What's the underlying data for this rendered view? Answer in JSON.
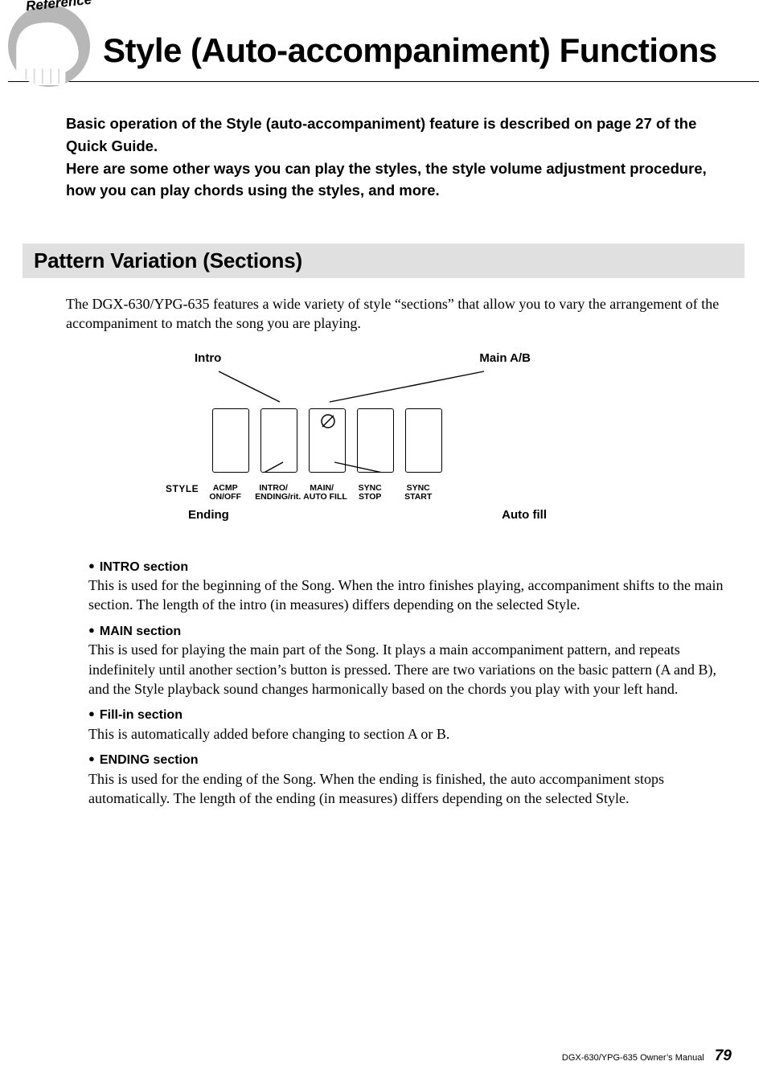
{
  "badge": {
    "text": "Reference"
  },
  "mainTitle": "Style (Auto-accompaniment) Functions",
  "introText": "Basic operation of the Style (auto-accompaniment) feature is described on page 27 of the Quick Guide.\nHere are some other ways you can play the styles, the style volume adjustment procedure, how you can play chords using the styles, and more.",
  "sectionBar": "Pattern Variation (Sections)",
  "sectionIntro": "The DGX-630/YPG-635 features a wide variety of style “sections” that allow you to vary the arrangement of the accompaniment to match the song you are playing.",
  "diagram": {
    "topLeft": "Intro",
    "topRight": "Main A/B",
    "styleLabel": "STYLE",
    "buttons": [
      "ACMP\nON/OFF",
      "INTRO/\nENDING/rit.",
      "MAIN/\nAUTO FILL",
      "SYNC\nSTOP",
      "SYNC\nSTART"
    ],
    "bottomLeft": "Ending",
    "bottomRight": "Auto fill"
  },
  "sections": [
    {
      "head": "INTRO section",
      "body": "This is used for the beginning of the Song. When the intro finishes playing, accompaniment shifts to the main section. The length of the intro (in measures) differs depending on the selected Style."
    },
    {
      "head": "MAIN section",
      "body": "This is used for playing the main part of the Song. It plays a main accompaniment pattern, and repeats indefinitely until another section’s button is pressed. There are two variations on the basic pattern (A and B), and the Style playback sound changes harmonically based on the chords you play with your left hand."
    },
    {
      "head": "Fill-in section",
      "body": "This is automatically added before changing to section A or B."
    },
    {
      "head": "ENDING section",
      "body": "This is used for the ending of the Song. When the ending is finished, the auto accompaniment stops automatically. The length of the ending (in measures) differs depending on the selected Style."
    }
  ],
  "footer": {
    "text": "DGX-630/YPG-635  Owner’s Manual",
    "page": "79"
  }
}
